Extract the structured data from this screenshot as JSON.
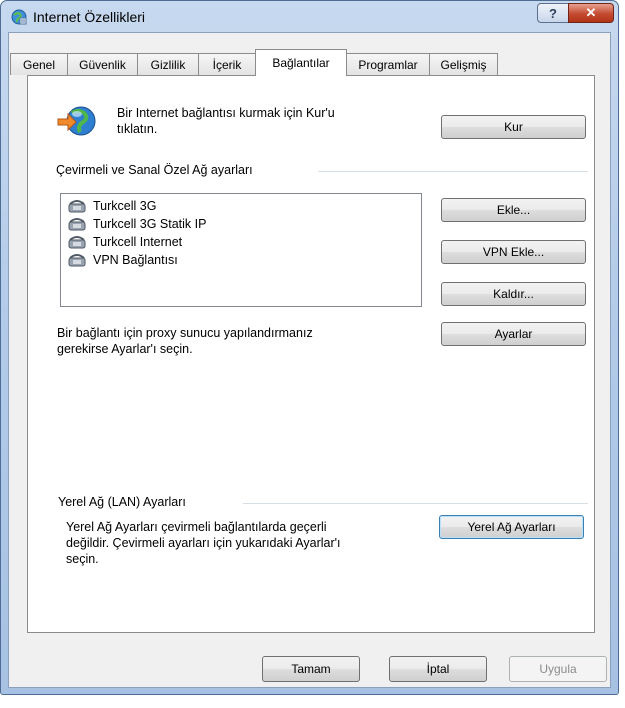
{
  "window": {
    "title": "Internet Özellikleri",
    "help_label": "?",
    "close_label": "✕"
  },
  "tabs": [
    {
      "label": "Genel"
    },
    {
      "label": "Güvenlik"
    },
    {
      "label": "Gizlilik"
    },
    {
      "label": "İçerik"
    },
    {
      "label": "Bağlantılar"
    },
    {
      "label": "Programlar"
    },
    {
      "label": "Gelişmiş"
    }
  ],
  "active_tab": "Bağlantılar",
  "setup": {
    "text_line1": "Bir Internet bağlantısı kurmak için Kur'u",
    "text_line2": "tıklatın.",
    "button": "Kur"
  },
  "dialup": {
    "group_label": "Çevirmeli ve Sanal Özel Ağ ayarları",
    "connections": [
      {
        "name": "Turkcell 3G"
      },
      {
        "name": "Turkcell 3G Statik IP"
      },
      {
        "name": "Turkcell Internet"
      },
      {
        "name": "VPN Bağlantısı"
      }
    ],
    "add_button": "Ekle...",
    "add_vpn_button": "VPN Ekle...",
    "remove_button": "Kaldır...",
    "proxy_text_line1": "Bir bağlantı için proxy sunucu yapılandırmanız",
    "proxy_text_line2": "gerekirse Ayarlar'ı seçin.",
    "settings_button": "Ayarlar"
  },
  "lan": {
    "group_label": "Yerel Ağ (LAN) Ayarları",
    "text_line1": "Yerel Ağ Ayarları çevirmeli bağlantılarda geçerli",
    "text_line2": "değildir. Çevirmeli ayarları için yukarıdaki Ayarlar'ı",
    "text_line3": "seçin.",
    "button": "Yerel Ağ Ayarları"
  },
  "footer": {
    "ok": "Tamam",
    "cancel": "İptal",
    "apply": "Uygula"
  }
}
